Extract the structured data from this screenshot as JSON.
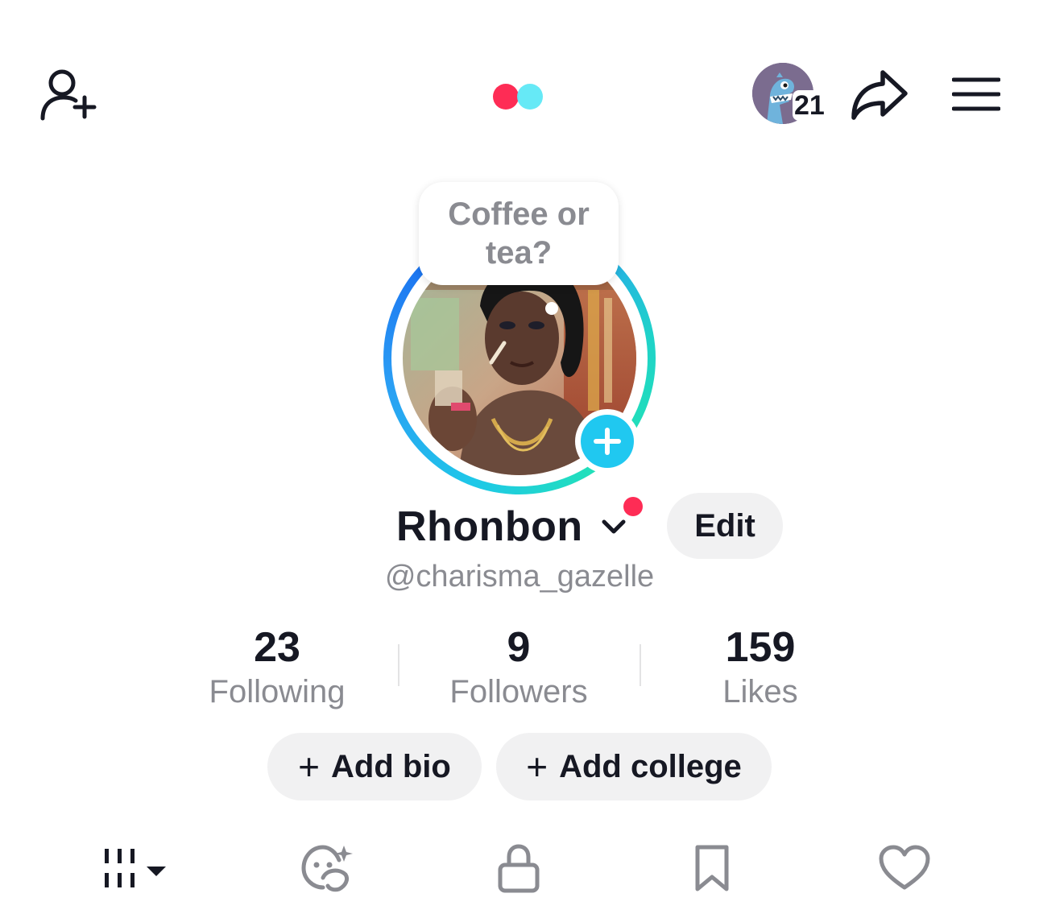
{
  "header": {
    "add_friend_icon": "person-plus-icon",
    "logo": "brand-dots-logo",
    "notification_count": "21",
    "share_icon": "share-arrow-icon",
    "menu_icon": "hamburger-menu-icon"
  },
  "profile": {
    "thought_bubble": "Coffee or tea?",
    "display_name": "Rhonbon",
    "username": "@charisma_gazelle",
    "edit_label": "Edit"
  },
  "stats": [
    {
      "value": "23",
      "label": "Following"
    },
    {
      "value": "9",
      "label": "Followers"
    },
    {
      "value": "159",
      "label": "Likes"
    }
  ],
  "actions": {
    "add_bio": "Add bio",
    "add_college": "Add college"
  },
  "tabs": [
    {
      "icon": "videos-grid-icon"
    },
    {
      "icon": "ai-face-icon"
    },
    {
      "icon": "lock-icon"
    },
    {
      "icon": "bookmark-icon"
    },
    {
      "icon": "heart-icon"
    }
  ],
  "colors": {
    "accent_red": "#fe2c55",
    "accent_cyan": "#20c8f0",
    "text_primary": "#161823",
    "text_secondary": "#8a8b91",
    "pill_bg": "#f1f1f2"
  }
}
